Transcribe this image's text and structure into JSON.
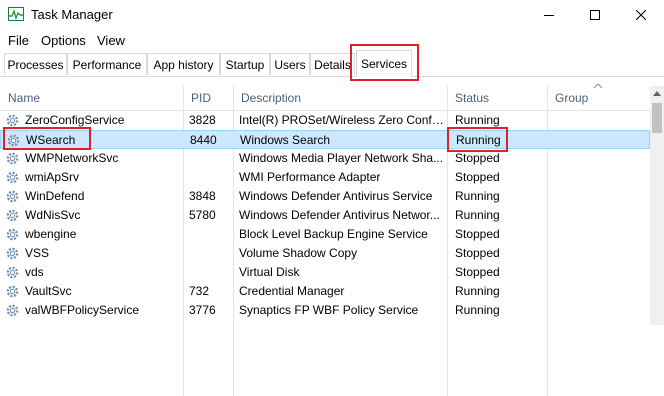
{
  "window": {
    "title": "Task Manager"
  },
  "menu": [
    "File",
    "Options",
    "View"
  ],
  "tabs": [
    "Processes",
    "Performance",
    "App history",
    "Startup",
    "Users",
    "Details",
    "Services"
  ],
  "active_tab": "Services",
  "columns": {
    "name": "Name",
    "pid": "PID",
    "description": "Description",
    "status": "Status",
    "group": "Group"
  },
  "rows": [
    {
      "name": "ZeroConfigService",
      "pid": "3828",
      "description": "Intel(R) PROSet/Wireless Zero Confi...",
      "status": "Running",
      "group": ""
    },
    {
      "name": "WSearch",
      "pid": "8440",
      "description": "Windows Search",
      "status": "Running",
      "group": "",
      "selected": true
    },
    {
      "name": "WMPNetworkSvc",
      "pid": "",
      "description": "Windows Media Player Network Sha...",
      "status": "Stopped",
      "group": ""
    },
    {
      "name": "wmiApSrv",
      "pid": "",
      "description": "WMI Performance Adapter",
      "status": "Stopped",
      "group": ""
    },
    {
      "name": "WinDefend",
      "pid": "3848",
      "description": "Windows Defender Antivirus Service",
      "status": "Running",
      "group": ""
    },
    {
      "name": "WdNisSvc",
      "pid": "5780",
      "description": "Windows Defender Antivirus Networ...",
      "status": "Running",
      "group": ""
    },
    {
      "name": "wbengine",
      "pid": "",
      "description": "Block Level Backup Engine Service",
      "status": "Stopped",
      "group": ""
    },
    {
      "name": "VSS",
      "pid": "",
      "description": "Volume Shadow Copy",
      "status": "Stopped",
      "group": ""
    },
    {
      "name": "vds",
      "pid": "",
      "description": "Virtual Disk",
      "status": "Stopped",
      "group": ""
    },
    {
      "name": "VaultSvc",
      "pid": "732",
      "description": "Credential Manager",
      "status": "Running",
      "group": ""
    },
    {
      "name": "valWBFPolicyService",
      "pid": "3776",
      "description": "Synaptics FP WBF Policy Service",
      "status": "Running",
      "group": ""
    }
  ],
  "icons": {
    "app": "task-manager-icon",
    "service": "gear-icon",
    "minimize": "minimize-icon",
    "maximize": "maximize-icon",
    "close": "close-icon",
    "sort": "chevron-up-icon",
    "scroll_up": "scroll-up-arrow-icon"
  },
  "colors": {
    "highlight": "#e0202a",
    "selection_bg": "#cce8ff",
    "header_text": "#4c607a"
  }
}
